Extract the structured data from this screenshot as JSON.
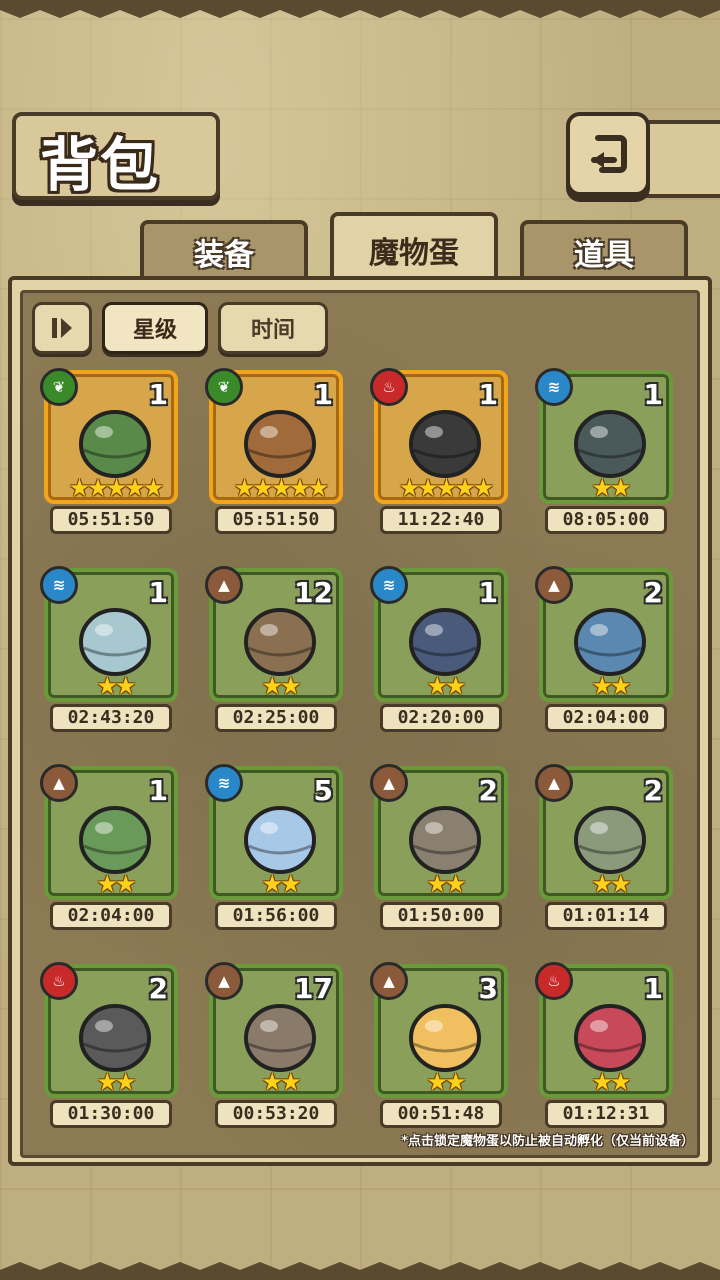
{
  "title": "背包",
  "tabs": [
    {
      "label": "装备",
      "active": false
    },
    {
      "label": "魔物蛋",
      "active": true
    },
    {
      "label": "道具",
      "active": false
    }
  ],
  "sort": {
    "toggle_icon": "sort-order-icon",
    "options": [
      {
        "label": "星级",
        "active": true
      },
      {
        "label": "时间",
        "active": false
      }
    ]
  },
  "eggs": [
    {
      "element": "leaf",
      "count": "1",
      "stars": 5,
      "time": "05:51:50",
      "rarity": "gold",
      "color": "#5a8a4a"
    },
    {
      "element": "leaf",
      "count": "1",
      "stars": 5,
      "time": "05:51:50",
      "rarity": "gold",
      "color": "#a06a3a"
    },
    {
      "element": "fire",
      "count": "1",
      "stars": 5,
      "time": "11:22:40",
      "rarity": "gold",
      "color": "#3a3a3a"
    },
    {
      "element": "water",
      "count": "1",
      "stars": 2,
      "time": "08:05:00",
      "rarity": "green",
      "color": "#4a5a5a"
    },
    {
      "element": "water",
      "count": "1",
      "stars": 2,
      "time": "02:43:20",
      "rarity": "green",
      "color": "#a8c8d0"
    },
    {
      "element": "earth",
      "count": "12",
      "stars": 2,
      "time": "02:25:00",
      "rarity": "green",
      "color": "#8a7050"
    },
    {
      "element": "water",
      "count": "1",
      "stars": 2,
      "time": "02:20:00",
      "rarity": "green",
      "color": "#4a5a7a"
    },
    {
      "element": "earth",
      "count": "2",
      "stars": 2,
      "time": "02:04:00",
      "rarity": "green",
      "color": "#5a88b0"
    },
    {
      "element": "earth",
      "count": "1",
      "stars": 2,
      "time": "02:04:00",
      "rarity": "green",
      "color": "#6a9a5a"
    },
    {
      "element": "water",
      "count": "5",
      "stars": 2,
      "time": "01:56:00",
      "rarity": "green",
      "color": "#a8c8e8"
    },
    {
      "element": "earth",
      "count": "2",
      "stars": 2,
      "time": "01:50:00",
      "rarity": "green",
      "color": "#8a8070"
    },
    {
      "element": "earth",
      "count": "2",
      "stars": 2,
      "time": "01:01:14",
      "rarity": "green",
      "color": "#8a9a7a"
    },
    {
      "element": "fire",
      "count": "2",
      "stars": 2,
      "time": "01:30:00",
      "rarity": "green",
      "color": "#5a5a5a"
    },
    {
      "element": "earth",
      "count": "17",
      "stars": 2,
      "time": "00:53:20",
      "rarity": "green",
      "color": "#8a7a6a"
    },
    {
      "element": "earth",
      "count": "3",
      "stars": 2,
      "time": "00:51:48",
      "rarity": "green",
      "color": "#f0c060"
    },
    {
      "element": "fire",
      "count": "1",
      "stars": 2,
      "time": "01:12:31",
      "rarity": "green",
      "color": "#c84a5a"
    }
  ],
  "footnote": "*点击锁定魔物蛋以防止被自动孵化（仅当前设备）",
  "back_icon": "return-arrow-icon"
}
